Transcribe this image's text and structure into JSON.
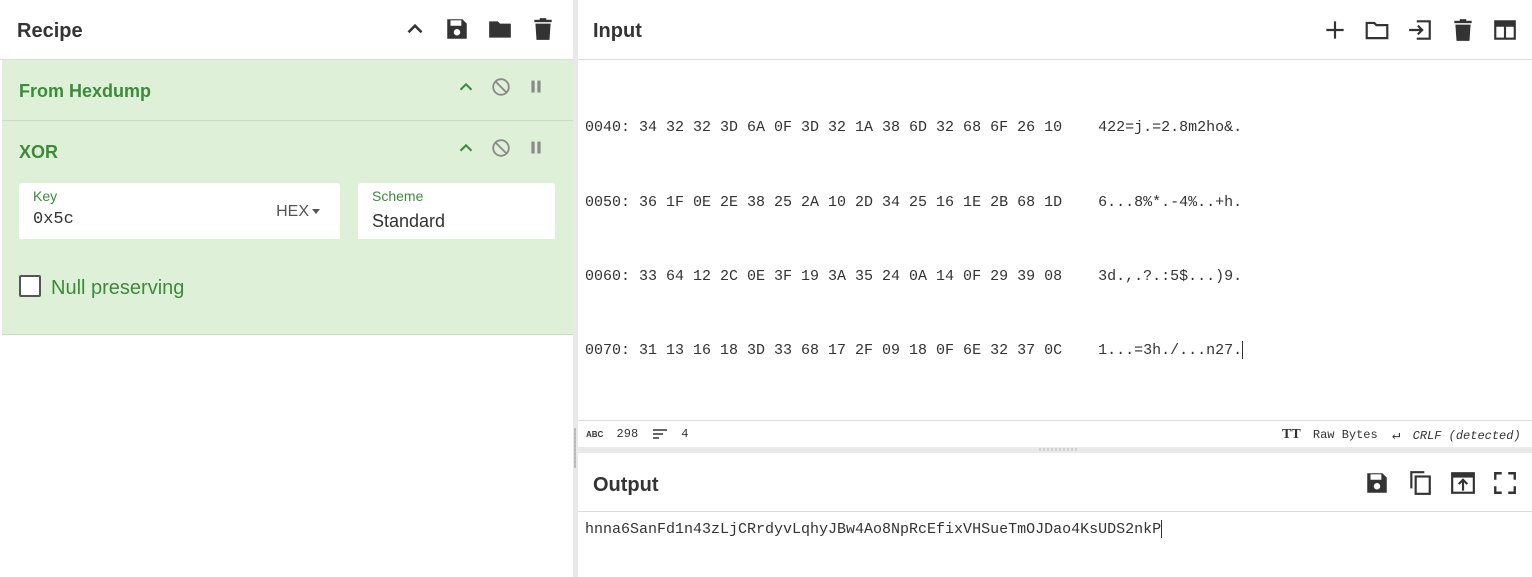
{
  "recipe": {
    "title": "Recipe",
    "operations": [
      {
        "name": "From Hexdump"
      },
      {
        "name": "XOR",
        "key_label": "Key",
        "key_value": "0x5c",
        "key_format": "HEX",
        "scheme_label": "Scheme",
        "scheme_value": "Standard",
        "null_preserving_label": "Null preserving",
        "null_preserving_checked": false
      }
    ]
  },
  "input": {
    "title": "Input",
    "lines": [
      "0040: 34 32 32 3D 6A 0F 3D 32 1A 38 6D 32 68 6F 26 10    422=j.=2.8m2ho&.",
      "0050: 36 1F 0E 2E 38 25 2A 10 2D 34 25 16 1E 2B 68 1D    6...8%*.-4%..+h.",
      "0060: 33 64 12 2C 0E 3F 19 3A 35 24 0A 14 0F 29 39 08    3d.,.?.:5$...)9.",
      "0070: 31 13 16 18 3D 33 68 17 2F 09 18 0F 6E 32 37 0C    1...=3h./...n27."
    ],
    "status": {
      "length": "298",
      "lines": "4",
      "encoding": "Raw Bytes",
      "eol": "CRLF (detected)"
    }
  },
  "output": {
    "title": "Output",
    "text": "hnna6SanFd1n43zLjCRrdyvLqhyJBw4Ao8NpRcEfixVHSueTmOJDao4KsUDS2nkP"
  },
  "icons": {
    "recipe_header": [
      "chevron-up-icon",
      "save-icon",
      "folder-icon",
      "trash-icon"
    ],
    "operation": [
      "chevron-up-icon",
      "disable-icon",
      "pause-icon"
    ],
    "input_header": [
      "plus-icon",
      "folder-icon",
      "import-icon",
      "trash-icon",
      "layout-icon"
    ],
    "output_header": [
      "save-icon",
      "copy-icon",
      "open-in-input-icon",
      "maximize-icon"
    ]
  },
  "colors": {
    "op_background": "#dff0d8",
    "op_text": "#3c8b3a",
    "icon": "#333333"
  }
}
